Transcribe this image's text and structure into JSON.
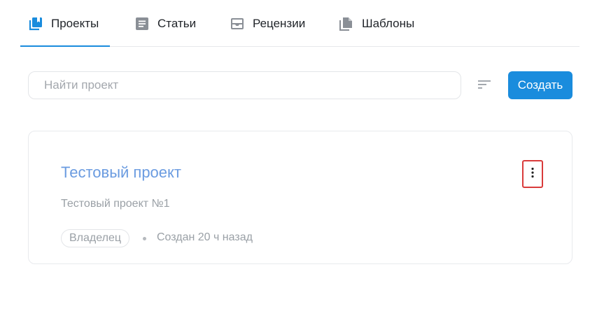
{
  "tabs": [
    {
      "label": "Проекты",
      "icon": "projects-icon",
      "active": true
    },
    {
      "label": "Статьи",
      "icon": "articles-icon",
      "active": false
    },
    {
      "label": "Рецензии",
      "icon": "reviews-icon",
      "active": false
    },
    {
      "label": "Шаблоны",
      "icon": "templates-icon",
      "active": false
    }
  ],
  "search": {
    "placeholder": "Найти проект",
    "value": ""
  },
  "toolbar": {
    "sort_icon": "sort-icon",
    "create_label": "Создать"
  },
  "project": {
    "title": "Тестовый проект",
    "description": "Тестовый проект №1",
    "role": "Владелец",
    "created": "Создан 20 ч назад",
    "menu_icon": "more-vertical-icon"
  },
  "colors": {
    "accent": "#1a8cdd",
    "link": "#6a9be0",
    "muted": "#9aa0a6",
    "focus": "#d93b3b"
  }
}
